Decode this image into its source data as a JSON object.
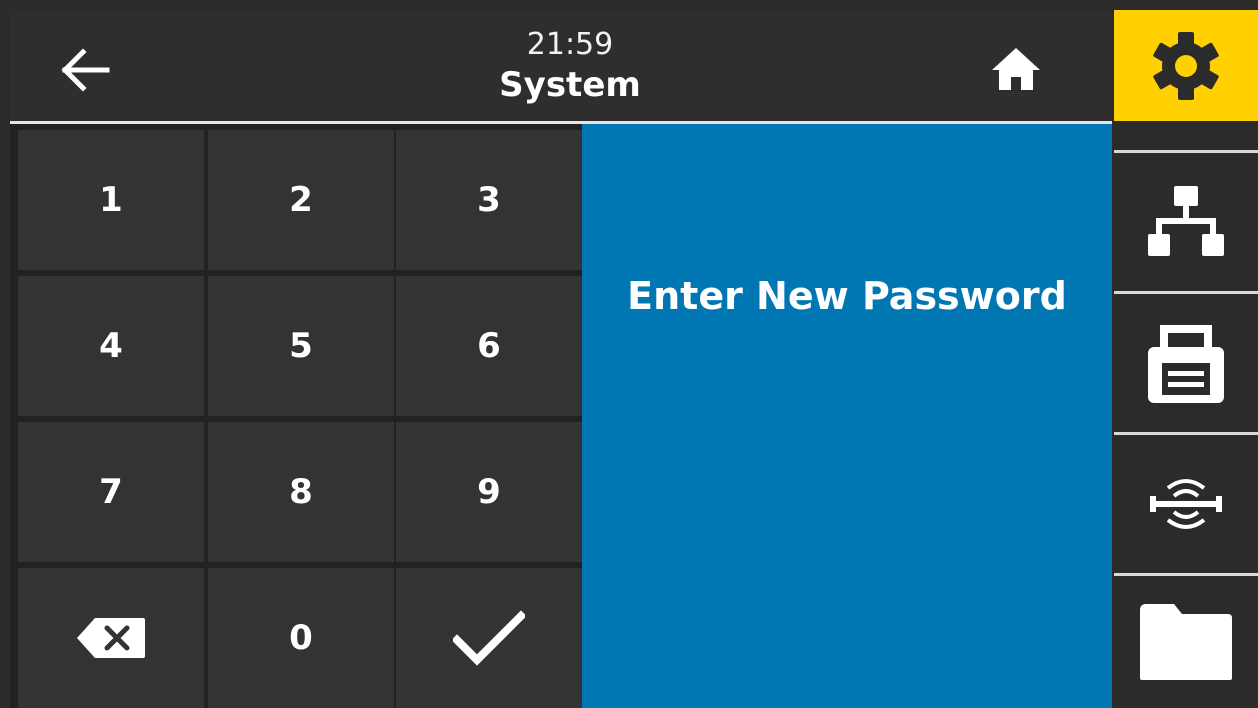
{
  "header": {
    "time": "21:59",
    "title": "System",
    "back_icon": "arrow-left-icon",
    "home_icon": "home-icon"
  },
  "keypad": {
    "keys": [
      "1",
      "2",
      "3",
      "4",
      "5",
      "6",
      "7",
      "8",
      "9",
      "0"
    ],
    "backspace_icon": "backspace-icon",
    "confirm_icon": "checkmark-icon"
  },
  "prompt": {
    "text": "Enter New Password"
  },
  "sidenav": {
    "items": [
      {
        "icon": "gear-icon",
        "active": true
      },
      {
        "icon": "network-icon",
        "active": false
      },
      {
        "icon": "printer-icon",
        "active": false
      },
      {
        "icon": "rfid-icon",
        "active": false
      },
      {
        "icon": "folder-icon",
        "active": false
      }
    ]
  },
  "colors": {
    "accent_yellow": "#ffd100",
    "panel_blue": "#0077b2",
    "background": "#2b2b2b",
    "key_background": "#333333"
  }
}
